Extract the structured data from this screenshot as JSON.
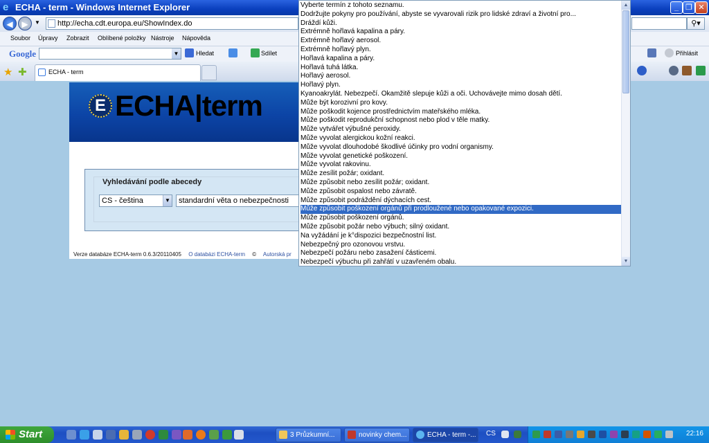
{
  "window": {
    "title": "ECHA - term - Windows Internet Explorer"
  },
  "address": {
    "url": "http://echa.cdt.europa.eu/ShowIndex.do"
  },
  "menu": [
    "Soubor",
    "Úpravy",
    "Zobrazit",
    "Oblíbené položky",
    "Nástroje",
    "Nápověda"
  ],
  "google": {
    "logo": "Google",
    "search": "Hledat",
    "share": "Sdílet",
    "signin": "Přihlásit"
  },
  "tab": {
    "label": "ECHA - term"
  },
  "page": {
    "brand": "ECHA|term",
    "panel_title": "Vyhledávání podle abecedy",
    "language_select": "CS - čeština",
    "type_select": "standardní věta o nebezpečnosti",
    "footer": {
      "version": "Verze databáze ECHA-term 0.6.3/20110405",
      "about": "O databázi ECHA-term",
      "copyright": "Autorská pr"
    }
  },
  "dropdown": {
    "selected_index": 23,
    "items": [
      "Vyberte termín z tohoto seznamu.",
      "Dodržujte pokyny pro používání, abyste se vyvarovali rizik pro lidské zdraví a životní pro...",
      "Dráždí kůži.",
      "Extrémně hořlavá kapalina a páry.",
      "Extrémně hořlavý aerosol.",
      "Extrémně hořlavý plyn.",
      "Hořlavá kapalina a páry.",
      "Hořlavá tuhá látka.",
      "Hořlavý aerosol.",
      "Hořlavý plyn.",
      "Kyanoakrylát. Nebezpečí. Okamžitě slepuje kůži a oči. Uchovávejte mimo dosah dětí.",
      "Může být korozivní pro kovy.",
      "Může poškodit kojence prostřednictvím mateřského mléka.",
      "Může poškodit reprodukční schopnost nebo plod v těle matky.",
      "Může vytvářet výbušné peroxidy.",
      "Může vyvolat alergickou kožní reakci.",
      "Může vyvolat dlouhodobé škodlivé účinky pro vodní organismy.",
      "Může vyvolat genetické poškození.",
      "Může vyvolat rakovinu.",
      "Může zesílit požár; oxidant.",
      "Může způsobit nebo zesílit požár; oxidant.",
      "Může způsobit ospalost nebo závratě.",
      "Může způsobit podráždění dýchacích cest.",
      "Může způsobit poškození orgánů při prodloužené nebo opakované expozici.",
      "Může způsobit poškození orgánů.",
      "Může způsobit požár nebo výbuch; silný oxidant.",
      "Na vyžádání je k°dispozici bezpečnostní list.",
      "Nebezpečný pro ozonovou vrstvu.",
      "Nebezpečí požáru nebo zasažení částicemi.",
      "Nebezpečí výbuchu při zahřátí v uzavřeném obalu."
    ]
  },
  "taskbar": {
    "start": "Start",
    "buttons": [
      "3 Průzkumní...",
      "novinky chem...",
      "ECHA - term -..."
    ],
    "lang": "CS",
    "clock": "22:16"
  },
  "colors": {
    "selection": "#316ac5",
    "page_bg": "#a6cae4",
    "banner": "#0c44a6"
  }
}
